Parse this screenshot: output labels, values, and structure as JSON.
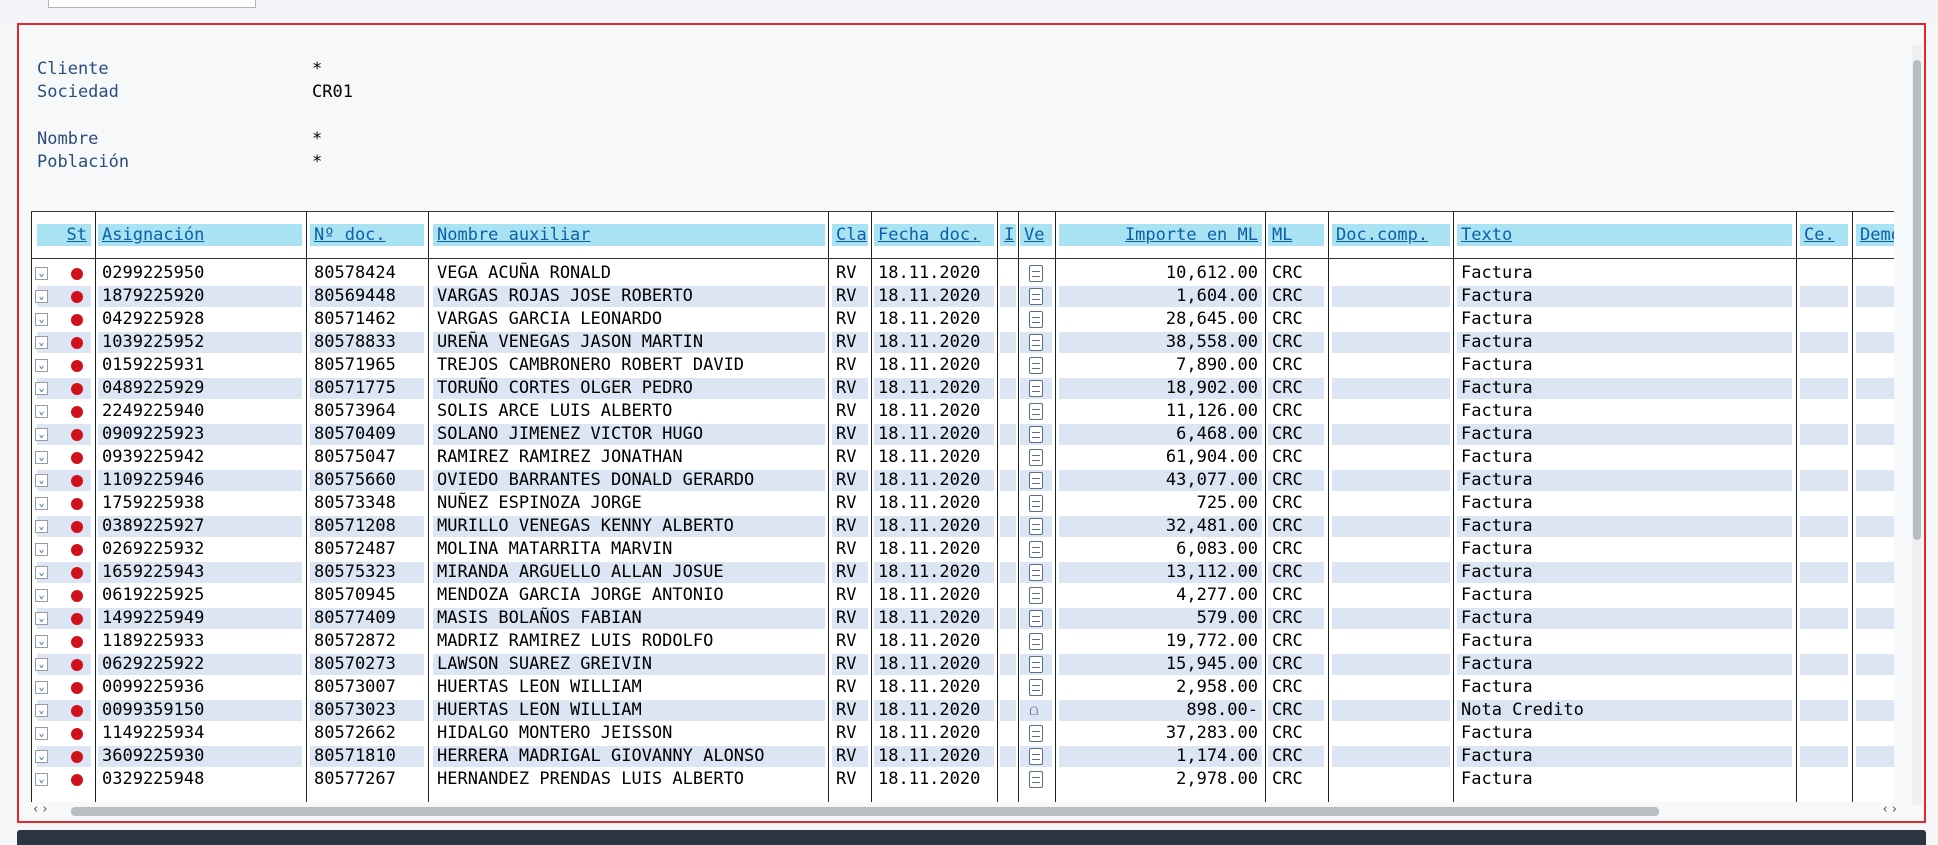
{
  "header": {
    "fields": [
      {
        "label": "Cliente",
        "value": "*"
      },
      {
        "label": "Sociedad",
        "value": "CR01"
      },
      {
        "label": "Nombre",
        "value": "*"
      },
      {
        "label": "Población",
        "value": "*"
      }
    ]
  },
  "columns": {
    "st": "St",
    "asignacion": "Asignación",
    "ndoc": "Nº doc.",
    "nombre": "Nombre auxiliar",
    "cla": "Cla",
    "fecha": "Fecha doc.",
    "i": "I",
    "ve": "Ve",
    "importe": "Importe en ML",
    "ml": "ML",
    "doccomp": "Doc.comp.",
    "texto": "Texto",
    "ce": "Ce.",
    "demo": "Demo"
  },
  "rows": [
    {
      "asig": "0299225950",
      "ndoc": "80578424",
      "nombre": "VEGA ACUÑA RONALD",
      "cla": "RV",
      "fecha": "18.11.2020",
      "icon": "document-icon",
      "importe": "10,612.00",
      "ml": "CRC",
      "texto": "Factura"
    },
    {
      "asig": "1879225920",
      "ndoc": "80569448",
      "nombre": "VARGAS ROJAS JOSE ROBERTO",
      "cla": "RV",
      "fecha": "18.11.2020",
      "icon": "document-icon",
      "importe": "1,604.00",
      "ml": "CRC",
      "texto": "Factura"
    },
    {
      "asig": "0429225928",
      "ndoc": "80571462",
      "nombre": "VARGAS GARCIA LEONARDO",
      "cla": "RV",
      "fecha": "18.11.2020",
      "icon": "document-icon",
      "importe": "28,645.00",
      "ml": "CRC",
      "texto": "Factura"
    },
    {
      "asig": "1039225952",
      "ndoc": "80578833",
      "nombre": "UREÑA VENEGAS JASON MARTIN",
      "cla": "RV",
      "fecha": "18.11.2020",
      "icon": "document-icon",
      "importe": "38,558.00",
      "ml": "CRC",
      "texto": "Factura"
    },
    {
      "asig": "0159225931",
      "ndoc": "80571965",
      "nombre": "TREJOS CAMBRONERO ROBERT DAVID",
      "cla": "RV",
      "fecha": "18.11.2020",
      "icon": "document-icon",
      "importe": "7,890.00",
      "ml": "CRC",
      "texto": "Factura"
    },
    {
      "asig": "0489225929",
      "ndoc": "80571775",
      "nombre": "TORUÑO CORTES OLGER PEDRO",
      "cla": "RV",
      "fecha": "18.11.2020",
      "icon": "document-icon",
      "importe": "18,902.00",
      "ml": "CRC",
      "texto": "Factura"
    },
    {
      "asig": "2249225940",
      "ndoc": "80573964",
      "nombre": "SOLIS ARCE LUIS ALBERTO",
      "cla": "RV",
      "fecha": "18.11.2020",
      "icon": "document-icon",
      "importe": "11,126.00",
      "ml": "CRC",
      "texto": "Factura"
    },
    {
      "asig": "0909225923",
      "ndoc": "80570409",
      "nombre": "SOLANO JIMENEZ VICTOR HUGO",
      "cla": "RV",
      "fecha": "18.11.2020",
      "icon": "document-icon",
      "importe": "6,468.00",
      "ml": "CRC",
      "texto": "Factura"
    },
    {
      "asig": "0939225942",
      "ndoc": "80575047",
      "nombre": "RAMIREZ RAMIREZ JONATHAN",
      "cla": "RV",
      "fecha": "18.11.2020",
      "icon": "document-icon",
      "importe": "61,904.00",
      "ml": "CRC",
      "texto": "Factura"
    },
    {
      "asig": "1109225946",
      "ndoc": "80575660",
      "nombre": "OVIEDO BARRANTES DONALD GERARDO",
      "cla": "RV",
      "fecha": "18.11.2020",
      "icon": "document-icon",
      "importe": "43,077.00",
      "ml": "CRC",
      "texto": "Factura"
    },
    {
      "asig": "1759225938",
      "ndoc": "80573348",
      "nombre": "NUÑEZ ESPINOZA JORGE",
      "cla": "RV",
      "fecha": "18.11.2020",
      "icon": "document-icon",
      "importe": "725.00",
      "ml": "CRC",
      "texto": "Factura"
    },
    {
      "asig": "0389225927",
      "ndoc": "80571208",
      "nombre": "MURILLO VENEGAS KENNY ALBERTO",
      "cla": "RV",
      "fecha": "18.11.2020",
      "icon": "document-icon",
      "importe": "32,481.00",
      "ml": "CRC",
      "texto": "Factura"
    },
    {
      "asig": "0269225932",
      "ndoc": "80572487",
      "nombre": "MOLINA MATARRITA MARVIN",
      "cla": "RV",
      "fecha": "18.11.2020",
      "icon": "document-icon",
      "importe": "6,083.00",
      "ml": "CRC",
      "texto": "Factura"
    },
    {
      "asig": "1659225943",
      "ndoc": "80575323",
      "nombre": "MIRANDA ARGUELLO ALLAN JOSUE",
      "cla": "RV",
      "fecha": "18.11.2020",
      "icon": "document-icon",
      "importe": "13,112.00",
      "ml": "CRC",
      "texto": "Factura"
    },
    {
      "asig": "0619225925",
      "ndoc": "80570945",
      "nombre": "MENDOZA GARCIA JORGE ANTONIO",
      "cla": "RV",
      "fecha": "18.11.2020",
      "icon": "document-icon",
      "importe": "4,277.00",
      "ml": "CRC",
      "texto": "Factura"
    },
    {
      "asig": "1499225949",
      "ndoc": "80577409",
      "nombre": "MASIS BOLAÑOS FABIAN",
      "cla": "RV",
      "fecha": "18.11.2020",
      "icon": "document-icon",
      "importe": "579.00",
      "ml": "CRC",
      "texto": "Factura"
    },
    {
      "asig": "1189225933",
      "ndoc": "80572872",
      "nombre": "MADRIZ RAMIREZ LUIS RODOLFO",
      "cla": "RV",
      "fecha": "18.11.2020",
      "icon": "document-icon",
      "importe": "19,772.00",
      "ml": "CRC",
      "texto": "Factura"
    },
    {
      "asig": "0629225922",
      "ndoc": "80570273",
      "nombre": "LAWSON SUAREZ GREIVIN",
      "cla": "RV",
      "fecha": "18.11.2020",
      "icon": "document-icon",
      "importe": "15,945.00",
      "ml": "CRC",
      "texto": "Factura"
    },
    {
      "asig": "0099225936",
      "ndoc": "80573007",
      "nombre": "HUERTAS LEON WILLIAM",
      "cla": "RV",
      "fecha": "18.11.2020",
      "icon": "document-icon",
      "importe": "2,958.00",
      "ml": "CRC",
      "texto": "Factura"
    },
    {
      "asig": "0099359150",
      "ndoc": "80573023",
      "nombre": "HUERTAS LEON WILLIAM",
      "cla": "RV",
      "fecha": "18.11.2020",
      "icon": "bell-icon",
      "importe": "898.00-",
      "ml": "CRC",
      "texto": "Nota Credito"
    },
    {
      "asig": "1149225934",
      "ndoc": "80572662",
      "nombre": "HIDALGO MONTERO JEISSON",
      "cla": "RV",
      "fecha": "18.11.2020",
      "icon": "document-icon",
      "importe": "37,283.00",
      "ml": "CRC",
      "texto": "Factura"
    },
    {
      "asig": "3609225930",
      "ndoc": "80571810",
      "nombre": "HERRERA MADRIGAL GIOVANNY ALONSO",
      "cla": "RV",
      "fecha": "18.11.2020",
      "icon": "document-icon",
      "importe": "1,174.00",
      "ml": "CRC",
      "texto": "Factura"
    },
    {
      "asig": "0329225948",
      "ndoc": "80577267",
      "nombre": "HERNANDEZ PRENDAS LUIS ALBERTO",
      "cla": "RV",
      "fecha": "18.11.2020",
      "icon": "document-icon",
      "importe": "2,978.00",
      "ml": "CRC",
      "texto": "Factura"
    }
  ],
  "colors": {
    "frame_border": "#e0282e",
    "header_bg": "#a8e2f3",
    "alt_row": "#dbe5f3",
    "status_red": "#d0101a"
  }
}
